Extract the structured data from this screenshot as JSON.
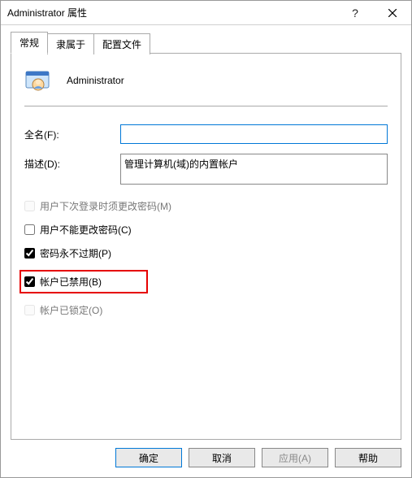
{
  "window": {
    "title": "Administrator 属性"
  },
  "tabs": {
    "general": "常规",
    "member_of": "隶属于",
    "profile": "配置文件"
  },
  "user": {
    "name": "Administrator"
  },
  "form": {
    "fullname_label": "全名(F):",
    "fullname_value": "",
    "description_label": "描述(D):",
    "description_value": "管理计算机(域)的内置帐户"
  },
  "checks": {
    "must_change": "用户下次登录时须更改密码(M)",
    "cannot_change": "用户不能更改密码(C)",
    "never_expires": "密码永不过期(P)",
    "disabled": "帐户已禁用(B)",
    "locked": "帐户已锁定(O)"
  },
  "buttons": {
    "ok": "确定",
    "cancel": "取消",
    "apply": "应用(A)",
    "help": "帮助"
  }
}
